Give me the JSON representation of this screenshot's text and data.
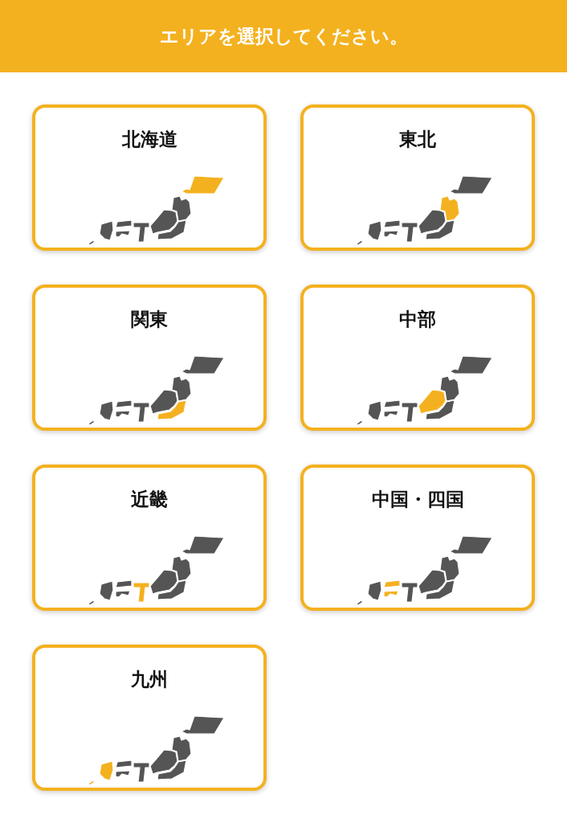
{
  "header": {
    "title": "エリアを選択してください。"
  },
  "areas": [
    {
      "label": "北海道",
      "kind": "hokkaido"
    },
    {
      "label": "東北",
      "kind": "tohoku"
    },
    {
      "label": "関東",
      "kind": "kanto"
    },
    {
      "label": "中部",
      "kind": "chubu"
    },
    {
      "label": "近畿",
      "kind": "kinki"
    },
    {
      "label": "中国・四国",
      "kind": "chushikoku"
    },
    {
      "label": "九州",
      "kind": "kyushu"
    }
  ]
}
